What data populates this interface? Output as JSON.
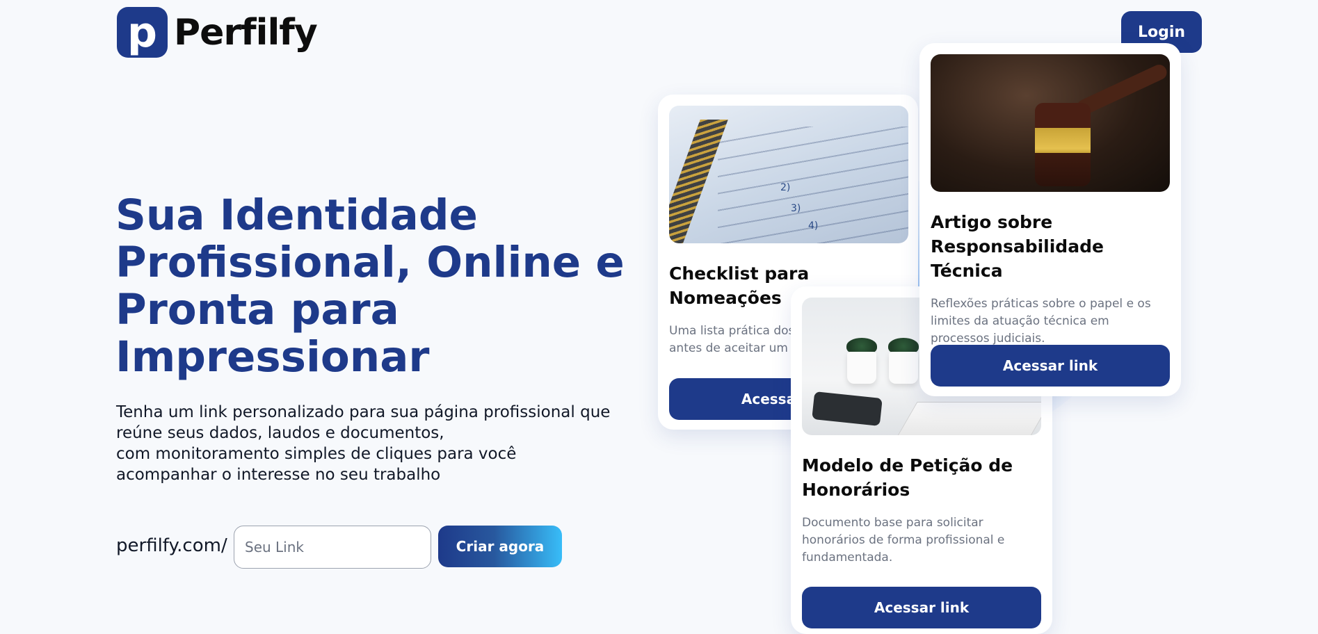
{
  "brand": {
    "logo_letter": "p",
    "name": "Perfilfy",
    "color": "#1e3a8a"
  },
  "header": {
    "login_label": "Login"
  },
  "hero": {
    "title": "Sua Identidade Profissional, Online e Pronta para Impressionar",
    "description_lines": [
      "Tenha um link personalizado para sua página profissional que",
      "reúne seus dados, laudos e documentos,",
      "com monitoramento simples de cliques para você",
      "acompanhar o interesse no seu trabalho"
    ]
  },
  "signup": {
    "prefix": "perfilfy.com/",
    "input_placeholder": "Seu Link",
    "input_value": "",
    "button_label": "Criar agora"
  },
  "cards": [
    {
      "title": "Checklist para Nomeações",
      "description": "Uma lista prática dos pontos a verificar antes de aceitar um novo encargo.",
      "button_label": "Acessar link",
      "image_icon": "notebook-photo"
    },
    {
      "title": "Modelo de Petição de Honorários",
      "description": "Documento base para solicitar honorários de forma profissional e fundamentada.",
      "button_label": "Acessar link",
      "image_icon": "desk-photo"
    },
    {
      "title": "Artigo sobre Responsabilidade Técnica",
      "description": "Reflexões práticas sobre o papel e os limites da atuação técnica em processos judiciais.",
      "button_label": "Acessar link",
      "image_icon": "gavel-photo"
    }
  ]
}
